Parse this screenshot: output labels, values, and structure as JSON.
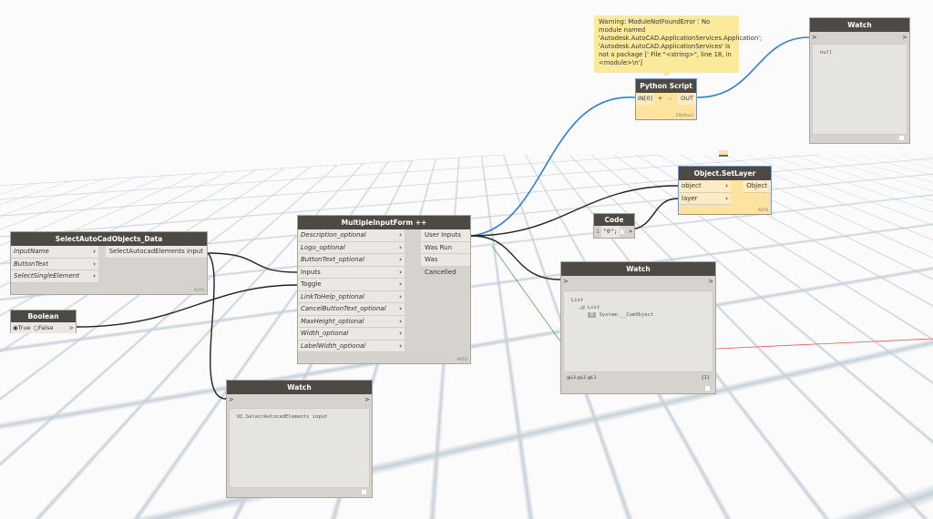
{
  "warning": "Warning: ModuleNotFoundError : No module named 'Autodesk.AutoCAD.ApplicationServices.Application'; 'Autodesk.AutoCAD.ApplicationServices' is not a package ['  File \"<string>\", line 18, in <module>\\n']",
  "python": {
    "title": "Python Script",
    "in": "IN[0]",
    "plus": "+",
    "minus": "-",
    "out": "OUT",
    "engine": "CPython3"
  },
  "watch_top": {
    "title": "Watch",
    "value": "null"
  },
  "setlayer": {
    "title": "Object.SetLayer",
    "inputs": [
      "object",
      "layer"
    ],
    "output": "Object",
    "lacing": "AUTO"
  },
  "codeblock": {
    "title": "Code Block",
    "line": "1",
    "code": "\"0\";"
  },
  "watch_mid": {
    "title": "Watch",
    "l0": "List",
    "l1": "List",
    "idx": "0",
    "item": "System.__ComObject",
    "levels": "@L3 @L2 @L1",
    "count": "{1}"
  },
  "select": {
    "title": "SelectAutoCadObjects_Data",
    "inputs": [
      "InputName",
      "ButtonText",
      "SelectSingleElement"
    ],
    "output": "SelectAutocadElements input",
    "lacing": "AUTO"
  },
  "boolean": {
    "title": "Boolean",
    "true": "True",
    "false": "False",
    "selected": "True"
  },
  "mif": {
    "title": "MultipleInputForm ++",
    "inputs": [
      "Description_optional",
      "Logo_optional",
      "ButtonText_optional",
      "Inputs",
      "Toggle",
      "LinkToHelp_optional",
      "CancelButtonText_optional",
      "MaxHeight_optional",
      "Width_optional",
      "LabelWidth_optional"
    ],
    "outputs": [
      "User Inputs",
      "Was Run",
      "Was Cancelled"
    ],
    "lacing": "AUTO"
  },
  "watch_bot": {
    "title": "Watch",
    "value": "UI.SelectAutocadElements input"
  },
  "colors": {
    "wire_active": "#2e7fd1",
    "wire": "#333333",
    "node_header": "#4d4a46",
    "selected_node": "#fde2a0"
  }
}
